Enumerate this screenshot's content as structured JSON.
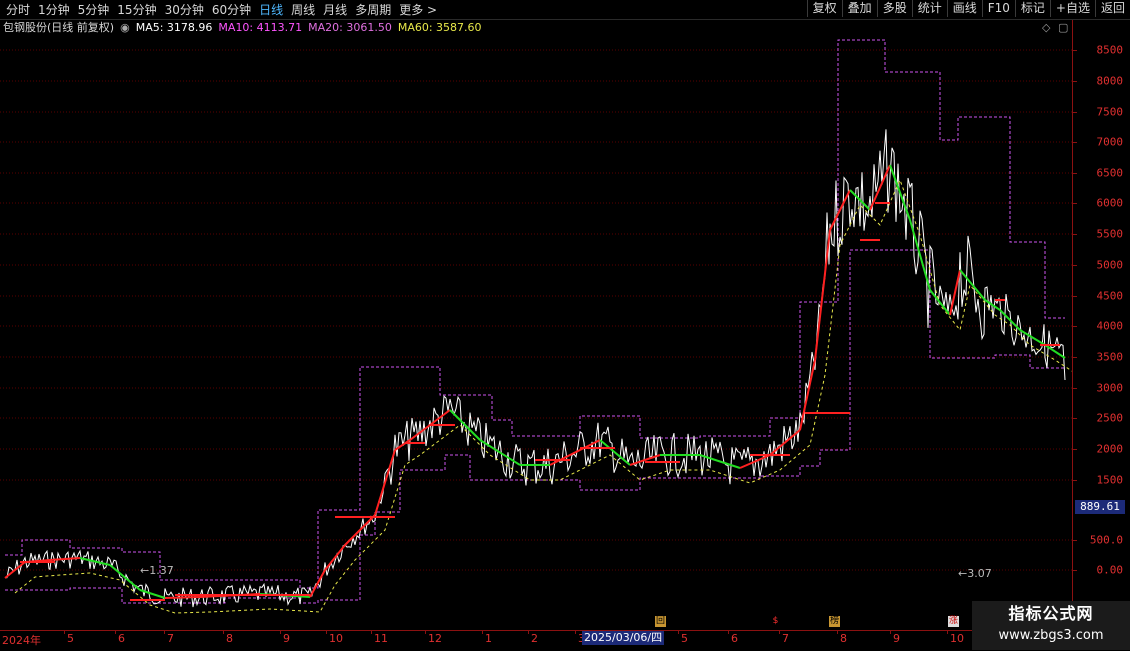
{
  "toolbar": {
    "periods": [
      "分时",
      "1分钟",
      "5分钟",
      "15分钟",
      "30分钟",
      "60分钟",
      "日线",
      "周线",
      "月线",
      "多周期",
      "更多 >"
    ],
    "active_period": "日线",
    "actions": [
      "复权",
      "叠加",
      "多股",
      "统计",
      "画线",
      "F10",
      "标记",
      "+自选",
      "返回"
    ]
  },
  "legend": {
    "title": "包钢股份(日线 前复权)",
    "items": [
      {
        "label": "MA5: 3178.96",
        "color": "#ffffff"
      },
      {
        "label": "MA10: 4113.71",
        "color": "#ff55ff"
      },
      {
        "label": "MA20: 3061.50",
        "color": "#e070e0"
      },
      {
        "label": "MA60: 3587.60",
        "color": "#e8e84a"
      }
    ]
  },
  "y_axis": {
    "labels": [
      "8500",
      "8000",
      "7500",
      "7000",
      "6500",
      "6000",
      "5500",
      "5000",
      "4500",
      "4000",
      "3500",
      "3000",
      "2500",
      "2000",
      "1500",
      "500.0",
      "0.00"
    ]
  },
  "current_price": "889.61",
  "x_axis": {
    "labels": [
      "2024年",
      "5",
      "6",
      "7",
      "8",
      "9",
      "10",
      "11",
      "12",
      "1",
      "2",
      "3",
      "2025/03/06/四",
      "5",
      "6",
      "7",
      "8",
      "9",
      "10"
    ]
  },
  "annotations": {
    "low_mark": "1.37",
    "right_mark": "3.07"
  },
  "events": [
    "回",
    "$",
    "榜",
    "涨"
  ],
  "watermark": {
    "line1": "指标公式网",
    "line2": "www.zbgs3.com"
  },
  "colors": {
    "up": "#ff2020",
    "down": "#22dd22",
    "grid": "#5a0000",
    "band": "#cc55ee",
    "ma60": "#e8e84a"
  }
}
